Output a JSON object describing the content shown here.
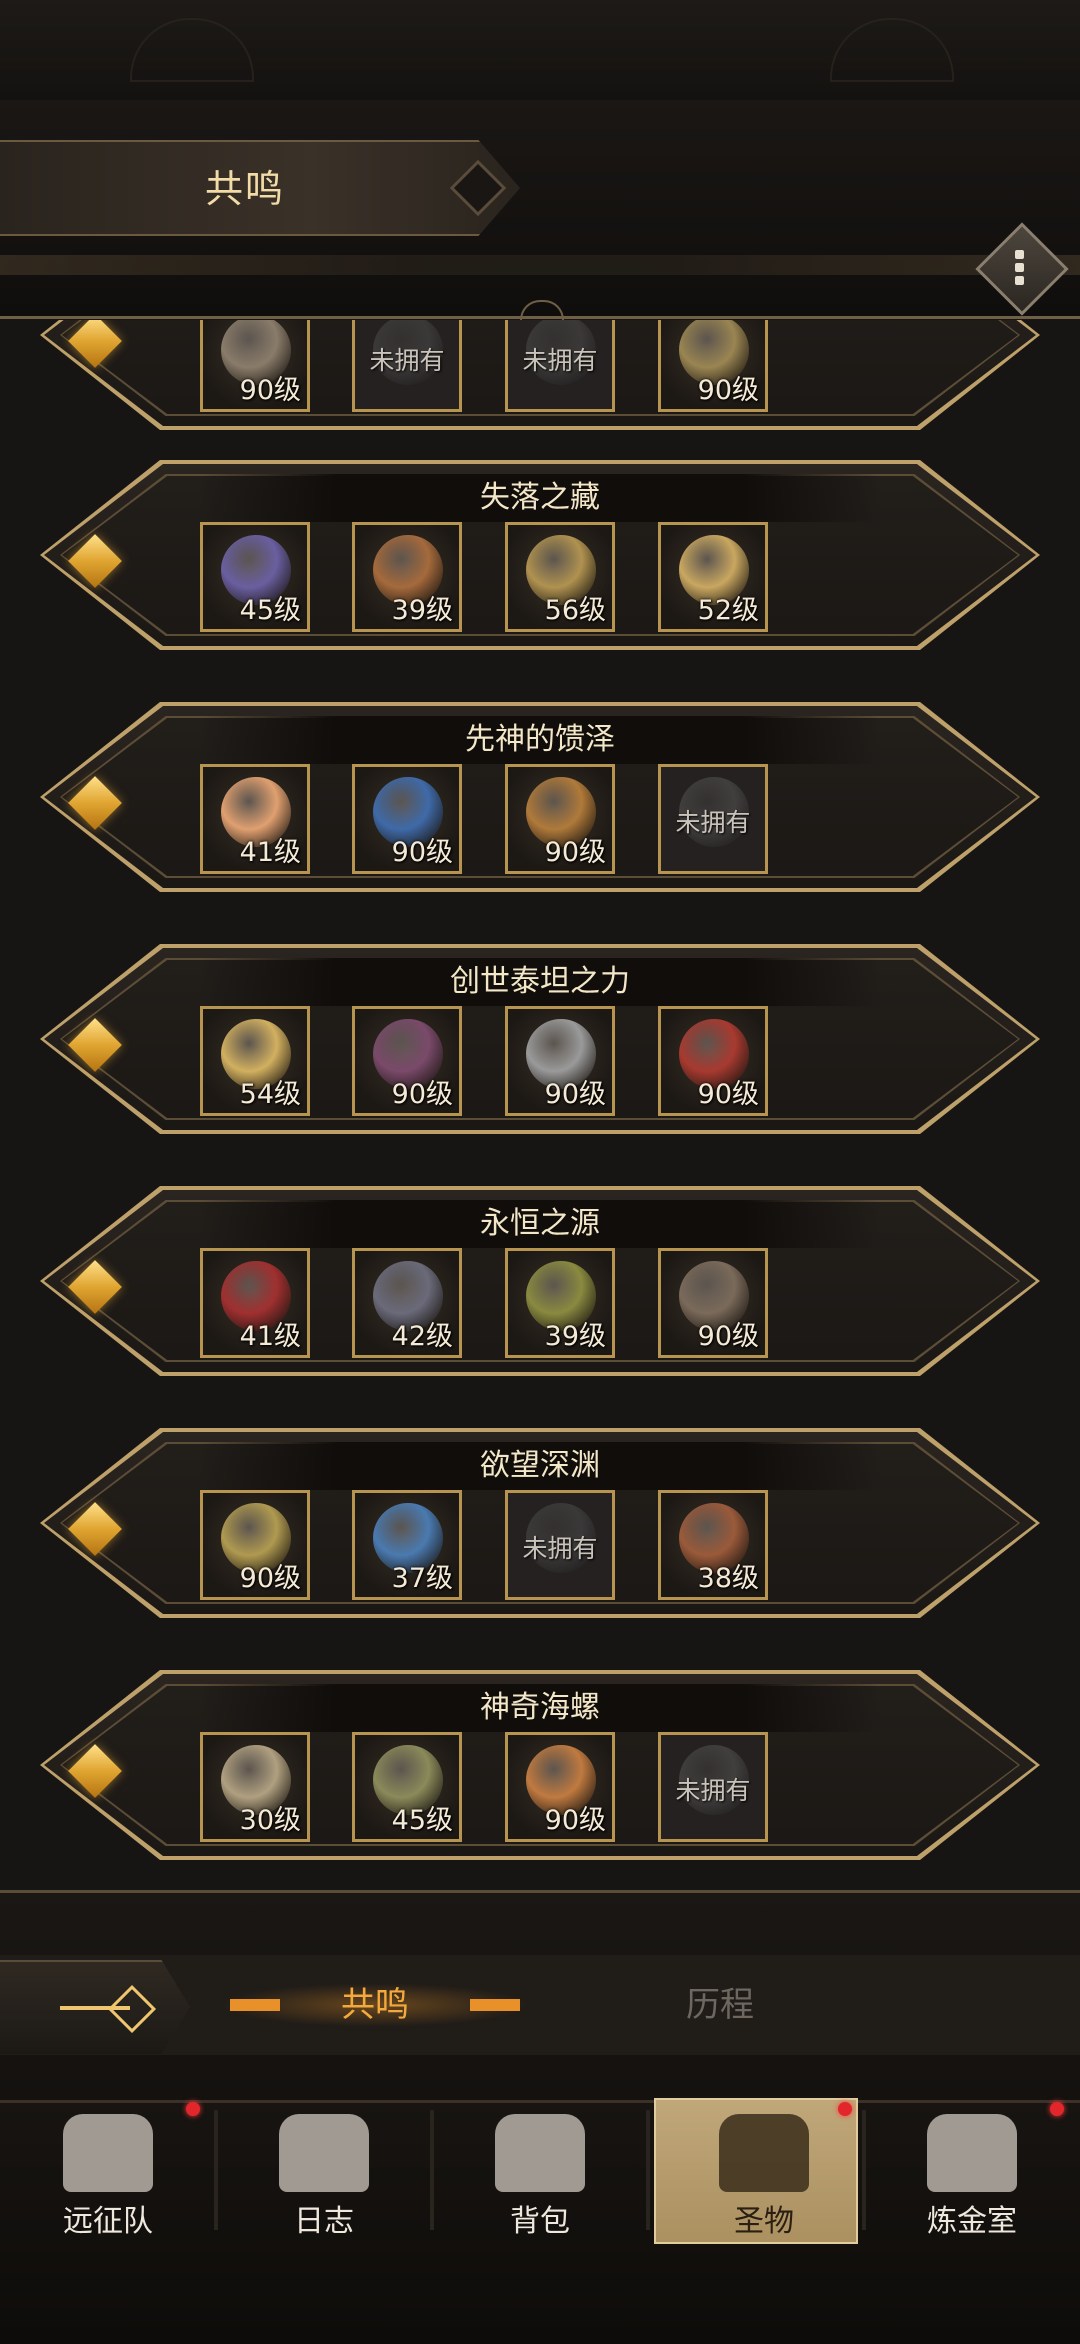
{
  "header": {
    "title": "共鸣",
    "menu_icon": "more-vertical-icon"
  },
  "rows": [
    {
      "title": "",
      "items": [
        {
          "level": "90级",
          "locked": false,
          "color": "#8a7c6a"
        },
        {
          "level": "未拥有",
          "locked": true,
          "color": "#666"
        },
        {
          "level": "未拥有",
          "locked": true,
          "color": "#666"
        },
        {
          "level": "90级",
          "locked": false,
          "color": "#9a8552"
        }
      ]
    },
    {
      "title": "失落之藏",
      "items": [
        {
          "level": "45级",
          "locked": false,
          "color": "#6a5fa0"
        },
        {
          "level": "39级",
          "locked": false,
          "color": "#a56a3c"
        },
        {
          "level": "56级",
          "locked": false,
          "color": "#b09250"
        },
        {
          "level": "52级",
          "locked": false,
          "color": "#c9a760"
        }
      ]
    },
    {
      "title": "先神的馈泽",
      "items": [
        {
          "level": "41级",
          "locked": false,
          "color": "#e0a070"
        },
        {
          "level": "90级",
          "locked": false,
          "color": "#3f6aa8"
        },
        {
          "level": "90级",
          "locked": false,
          "color": "#b07a3a"
        },
        {
          "level": "未拥有",
          "locked": true,
          "color": "#777"
        }
      ]
    },
    {
      "title": "创世泰坦之力",
      "items": [
        {
          "level": "54级",
          "locked": false,
          "color": "#d2b060"
        },
        {
          "level": "90级",
          "locked": false,
          "color": "#7a4a6a"
        },
        {
          "level": "90级",
          "locked": false,
          "color": "#9a9a9a"
        },
        {
          "level": "90级",
          "locked": false,
          "color": "#a83a30"
        }
      ]
    },
    {
      "title": "永恒之源",
      "items": [
        {
          "level": "41级",
          "locked": false,
          "color": "#a03030"
        },
        {
          "level": "42级",
          "locked": false,
          "color": "#6a6a7a"
        },
        {
          "level": "39级",
          "locked": false,
          "color": "#8a8a40"
        },
        {
          "level": "90级",
          "locked": false,
          "color": "#7a6a5a"
        }
      ]
    },
    {
      "title": "欲望深渊",
      "items": [
        {
          "level": "90级",
          "locked": false,
          "color": "#b09a50"
        },
        {
          "level": "37级",
          "locked": false,
          "color": "#4a7ab0"
        },
        {
          "level": "未拥有",
          "locked": true,
          "color": "#666"
        },
        {
          "level": "38级",
          "locked": false,
          "color": "#9a5a3a"
        }
      ]
    },
    {
      "title": "神奇海螺",
      "items": [
        {
          "level": "30级",
          "locked": false,
          "color": "#b0a080"
        },
        {
          "level": "45级",
          "locked": false,
          "color": "#8a8a5a"
        },
        {
          "level": "90级",
          "locked": false,
          "color": "#c07a40"
        },
        {
          "level": "未拥有",
          "locked": true,
          "color": "#777"
        }
      ]
    }
  ],
  "segment_tabs": {
    "active": "共鸣",
    "inactive": "历程"
  },
  "nav": [
    {
      "label": "远征队",
      "icon": "viking-helmet-icon",
      "badge": true,
      "active": false
    },
    {
      "label": "日志",
      "icon": "scroll-map-icon",
      "badge": false,
      "active": false
    },
    {
      "label": "背包",
      "icon": "backpack-icon",
      "badge": false,
      "active": false
    },
    {
      "label": "圣物",
      "icon": "torch-relic-icon",
      "badge": true,
      "active": true
    },
    {
      "label": "炼金室",
      "icon": "alchemy-symbol-icon",
      "badge": true,
      "active": false
    }
  ],
  "colors": {
    "gold": "#bda06a",
    "active_tab": "#f3a93c",
    "badge": "#e3262b"
  }
}
